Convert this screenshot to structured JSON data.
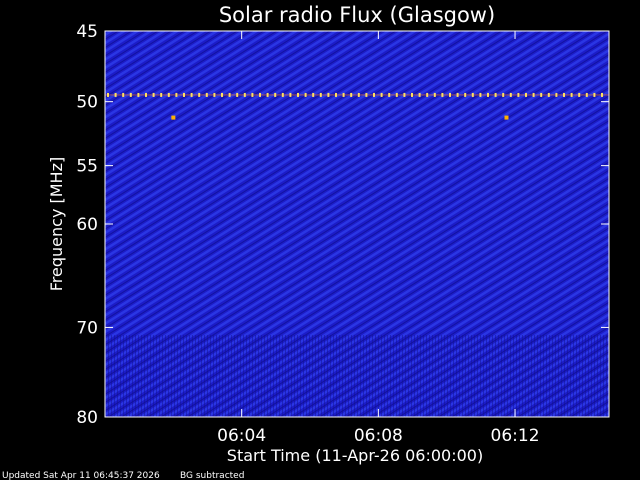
{
  "chart_data": {
    "type": "heatmap",
    "title": "Solar radio Flux (Glasgow)",
    "xlabel": "Start Time (11-Apr-26 06:00:00)",
    "ylabel": "Frequency [MHz]",
    "ylim": [
      80,
      45
    ],
    "y_scale": "log",
    "xlim": [
      "06:00:00",
      "06:14:45"
    ],
    "y_ticks": [
      {
        "value": 45,
        "label": "45"
      },
      {
        "value": 50,
        "label": "50"
      },
      {
        "value": 55,
        "label": "55"
      },
      {
        "value": 60,
        "label": "60"
      },
      {
        "value": 70,
        "label": "70"
      },
      {
        "value": 80,
        "label": "80"
      }
    ],
    "x_ticks": [
      {
        "value": "06:04",
        "label": "06:04"
      },
      {
        "value": "06:08",
        "label": "06:08"
      },
      {
        "value": "06:12",
        "label": "06:12"
      }
    ],
    "features": {
      "interference_line_mhz": 49.5,
      "spots": [
        {
          "time": "06:02:00",
          "mhz": 51.2
        },
        {
          "time": "06:11:45",
          "mhz": 51.2
        }
      ]
    },
    "background_color": "#1a1acc",
    "grid": false
  },
  "footer": {
    "updated": "Updated Sat Apr 11 06:45:37 2026",
    "note": "BG subtracted"
  }
}
